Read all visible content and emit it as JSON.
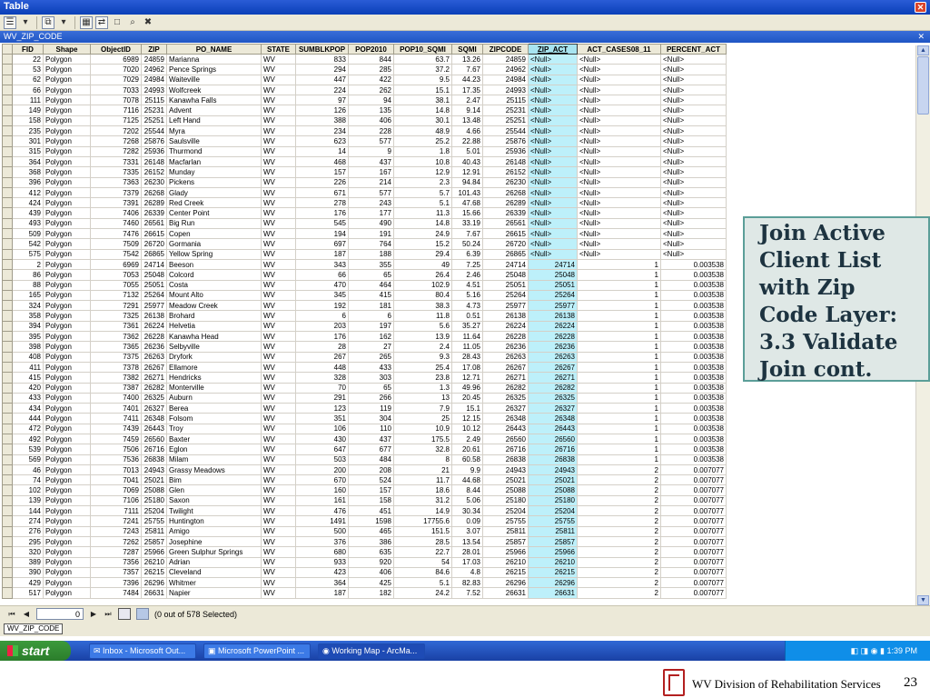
{
  "window": {
    "title": "Table",
    "close_glyph": "✕"
  },
  "toolbar": {
    "icons": [
      "table-options-icon",
      "dropdown-icon",
      "related-tables-icon",
      "dropdown-icon",
      "select-by-attributes-icon",
      "switch-selection-icon",
      "clear-selection-icon",
      "zoom-to-selected-icon",
      "delete-selected-icon"
    ]
  },
  "tab": {
    "title": "WV_ZIP_CODE",
    "close_glyph": "✕"
  },
  "table": {
    "columns": [
      "FID",
      "Shape",
      "ObjectID",
      "ZIP",
      "PO_NAME",
      "STATE",
      "SUMBLKPOP",
      "POP2010",
      "POP10_SQMI",
      "SQMI",
      "ZIPCODE",
      "ZIP_ACT",
      "ACT_CASES08_11",
      "PERCENT_ACT"
    ],
    "highlighted_column": "ZIP_ACT",
    "rows": [
      [
        "22",
        "Polygon",
        "6989",
        "24859",
        "Marianna",
        "WV",
        "833",
        "844",
        "63.7",
        "13.26",
        "24859",
        "<Null>",
        "<Null>",
        "<Null>"
      ],
      [
        "53",
        "Polygon",
        "7020",
        "24962",
        "Pence Springs",
        "WV",
        "294",
        "285",
        "37.2",
        "7.67",
        "24962",
        "<Null>",
        "<Null>",
        "<Null>"
      ],
      [
        "62",
        "Polygon",
        "7029",
        "24984",
        "Waiteville",
        "WV",
        "447",
        "422",
        "9.5",
        "44.23",
        "24984",
        "<Null>",
        "<Null>",
        "<Null>"
      ],
      [
        "66",
        "Polygon",
        "7033",
        "24993",
        "Wolfcreek",
        "WV",
        "224",
        "262",
        "15.1",
        "17.35",
        "24993",
        "<Null>",
        "<Null>",
        "<Null>"
      ],
      [
        "111",
        "Polygon",
        "7078",
        "25115",
        "Kanawha Falls",
        "WV",
        "97",
        "94",
        "38.1",
        "2.47",
        "25115",
        "<Null>",
        "<Null>",
        "<Null>"
      ],
      [
        "149",
        "Polygon",
        "7116",
        "25231",
        "Advent",
        "WV",
        "126",
        "135",
        "14.8",
        "9.14",
        "25231",
        "<Null>",
        "<Null>",
        "<Null>"
      ],
      [
        "158",
        "Polygon",
        "7125",
        "25251",
        "Left Hand",
        "WV",
        "388",
        "406",
        "30.1",
        "13.48",
        "25251",
        "<Null>",
        "<Null>",
        "<Null>"
      ],
      [
        "235",
        "Polygon",
        "7202",
        "25544",
        "Myra",
        "WV",
        "234",
        "228",
        "48.9",
        "4.66",
        "25544",
        "<Null>",
        "<Null>",
        "<Null>"
      ],
      [
        "301",
        "Polygon",
        "7268",
        "25876",
        "Saulsville",
        "WV",
        "623",
        "577",
        "25.2",
        "22.88",
        "25876",
        "<Null>",
        "<Null>",
        "<Null>"
      ],
      [
        "315",
        "Polygon",
        "7282",
        "25936",
        "Thurmond",
        "WV",
        "14",
        "9",
        "1.8",
        "5.01",
        "25936",
        "<Null>",
        "<Null>",
        "<Null>"
      ],
      [
        "364",
        "Polygon",
        "7331",
        "26148",
        "Macfarlan",
        "WV",
        "468",
        "437",
        "10.8",
        "40.43",
        "26148",
        "<Null>",
        "<Null>",
        "<Null>"
      ],
      [
        "368",
        "Polygon",
        "7335",
        "26152",
        "Munday",
        "WV",
        "157",
        "167",
        "12.9",
        "12.91",
        "26152",
        "<Null>",
        "<Null>",
        "<Null>"
      ],
      [
        "396",
        "Polygon",
        "7363",
        "26230",
        "Pickens",
        "WV",
        "226",
        "214",
        "2.3",
        "94.84",
        "26230",
        "<Null>",
        "<Null>",
        "<Null>"
      ],
      [
        "412",
        "Polygon",
        "7379",
        "26268",
        "Glady",
        "WV",
        "671",
        "577",
        "5.7",
        "101.43",
        "26268",
        "<Null>",
        "<Null>",
        "<Null>"
      ],
      [
        "424",
        "Polygon",
        "7391",
        "26289",
        "Red Creek",
        "WV",
        "278",
        "243",
        "5.1",
        "47.68",
        "26289",
        "<Null>",
        "<Null>",
        "<Null>"
      ],
      [
        "439",
        "Polygon",
        "7406",
        "26339",
        "Center Point",
        "WV",
        "176",
        "177",
        "11.3",
        "15.66",
        "26339",
        "<Null>",
        "<Null>",
        "<Null>"
      ],
      [
        "493",
        "Polygon",
        "7460",
        "26561",
        "Big Run",
        "WV",
        "545",
        "490",
        "14.8",
        "33.19",
        "26561",
        "<Null>",
        "<Null>",
        "<Null>"
      ],
      [
        "509",
        "Polygon",
        "7476",
        "26615",
        "Copen",
        "WV",
        "194",
        "191",
        "24.9",
        "7.67",
        "26615",
        "<Null>",
        "<Null>",
        "<Null>"
      ],
      [
        "542",
        "Polygon",
        "7509",
        "26720",
        "Gormania",
        "WV",
        "697",
        "764",
        "15.2",
        "50.24",
        "26720",
        "<Null>",
        "<Null>",
        "<Null>"
      ],
      [
        "575",
        "Polygon",
        "7542",
        "26865",
        "Yellow Spring",
        "WV",
        "187",
        "188",
        "29.4",
        "6.39",
        "26865",
        "<Null>",
        "<Null>",
        "<Null>"
      ],
      [
        "2",
        "Polygon",
        "6969",
        "24714",
        "Beeson",
        "WV",
        "343",
        "355",
        "49",
        "7.25",
        "24714",
        "24714",
        "1",
        "0.003538"
      ],
      [
        "86",
        "Polygon",
        "7053",
        "25048",
        "Colcord",
        "WV",
        "66",
        "65",
        "26.4",
        "2.46",
        "25048",
        "25048",
        "1",
        "0.003538"
      ],
      [
        "88",
        "Polygon",
        "7055",
        "25051",
        "Costa",
        "WV",
        "470",
        "464",
        "102.9",
        "4.51",
        "25051",
        "25051",
        "1",
        "0.003538"
      ],
      [
        "165",
        "Polygon",
        "7132",
        "25264",
        "Mount Alto",
        "WV",
        "345",
        "415",
        "80.4",
        "5.16",
        "25264",
        "25264",
        "1",
        "0.003538"
      ],
      [
        "324",
        "Polygon",
        "7291",
        "25977",
        "Meadow Creek",
        "WV",
        "192",
        "181",
        "38.3",
        "4.73",
        "25977",
        "25977",
        "1",
        "0.003538"
      ],
      [
        "358",
        "Polygon",
        "7325",
        "26138",
        "Brohard",
        "WV",
        "6",
        "6",
        "11.8",
        "0.51",
        "26138",
        "26138",
        "1",
        "0.003538"
      ],
      [
        "394",
        "Polygon",
        "7361",
        "26224",
        "Helvetia",
        "WV",
        "203",
        "197",
        "5.6",
        "35.27",
        "26224",
        "26224",
        "1",
        "0.003538"
      ],
      [
        "395",
        "Polygon",
        "7362",
        "26228",
        "Kanawha Head",
        "WV",
        "176",
        "162",
        "13.9",
        "11.64",
        "26228",
        "26228",
        "1",
        "0.003538"
      ],
      [
        "398",
        "Polygon",
        "7365",
        "26236",
        "Selbyville",
        "WV",
        "28",
        "27",
        "2.4",
        "11.05",
        "26236",
        "26236",
        "1",
        "0.003538"
      ],
      [
        "408",
        "Polygon",
        "7375",
        "26263",
        "Dryfork",
        "WV",
        "267",
        "265",
        "9.3",
        "28.43",
        "26263",
        "26263",
        "1",
        "0.003538"
      ],
      [
        "411",
        "Polygon",
        "7378",
        "26267",
        "Ellamore",
        "WV",
        "448",
        "433",
        "25.4",
        "17.08",
        "26267",
        "26267",
        "1",
        "0.003538"
      ],
      [
        "415",
        "Polygon",
        "7382",
        "26271",
        "Hendricks",
        "WV",
        "328",
        "303",
        "23.8",
        "12.71",
        "26271",
        "26271",
        "1",
        "0.003538"
      ],
      [
        "420",
        "Polygon",
        "7387",
        "26282",
        "Monterville",
        "WV",
        "70",
        "65",
        "1.3",
        "49.96",
        "26282",
        "26282",
        "1",
        "0.003538"
      ],
      [
        "433",
        "Polygon",
        "7400",
        "26325",
        "Auburn",
        "WV",
        "291",
        "266",
        "13",
        "20.45",
        "26325",
        "26325",
        "1",
        "0.003538"
      ],
      [
        "434",
        "Polygon",
        "7401",
        "26327",
        "Berea",
        "WV",
        "123",
        "119",
        "7.9",
        "15.1",
        "26327",
        "26327",
        "1",
        "0.003538"
      ],
      [
        "444",
        "Polygon",
        "7411",
        "26348",
        "Folsom",
        "WV",
        "351",
        "304",
        "25",
        "12.15",
        "26348",
        "26348",
        "1",
        "0.003538"
      ],
      [
        "472",
        "Polygon",
        "7439",
        "26443",
        "Troy",
        "WV",
        "106",
        "110",
        "10.9",
        "10.12",
        "26443",
        "26443",
        "1",
        "0.003538"
      ],
      [
        "492",
        "Polygon",
        "7459",
        "26560",
        "Baxter",
        "WV",
        "430",
        "437",
        "175.5",
        "2.49",
        "26560",
        "26560",
        "1",
        "0.003538"
      ],
      [
        "539",
        "Polygon",
        "7506",
        "26716",
        "Eglon",
        "WV",
        "647",
        "677",
        "32.8",
        "20.61",
        "26716",
        "26716",
        "1",
        "0.003538"
      ],
      [
        "569",
        "Polygon",
        "7536",
        "26838",
        "Milam",
        "WV",
        "503",
        "484",
        "8",
        "60.58",
        "26838",
        "26838",
        "1",
        "0.003538"
      ],
      [
        "46",
        "Polygon",
        "7013",
        "24943",
        "Grassy Meadows",
        "WV",
        "200",
        "208",
        "21",
        "9.9",
        "24943",
        "24943",
        "2",
        "0.007077"
      ],
      [
        "74",
        "Polygon",
        "7041",
        "25021",
        "Bim",
        "WV",
        "670",
        "524",
        "11.7",
        "44.68",
        "25021",
        "25021",
        "2",
        "0.007077"
      ],
      [
        "102",
        "Polygon",
        "7069",
        "25088",
        "Glen",
        "WV",
        "160",
        "157",
        "18.6",
        "8.44",
        "25088",
        "25088",
        "2",
        "0.007077"
      ],
      [
        "139",
        "Polygon",
        "7106",
        "25180",
        "Saxon",
        "WV",
        "161",
        "158",
        "31.2",
        "5.06",
        "25180",
        "25180",
        "2",
        "0.007077"
      ],
      [
        "144",
        "Polygon",
        "7111",
        "25204",
        "Twilight",
        "WV",
        "476",
        "451",
        "14.9",
        "30.34",
        "25204",
        "25204",
        "2",
        "0.007077"
      ],
      [
        "274",
        "Polygon",
        "7241",
        "25755",
        "Huntington",
        "WV",
        "1491",
        "1598",
        "17755.6",
        "0.09",
        "25755",
        "25755",
        "2",
        "0.007077"
      ],
      [
        "276",
        "Polygon",
        "7243",
        "25811",
        "Amigo",
        "WV",
        "500",
        "465",
        "151.5",
        "3.07",
        "25811",
        "25811",
        "2",
        "0.007077"
      ],
      [
        "295",
        "Polygon",
        "7262",
        "25857",
        "Josephine",
        "WV",
        "376",
        "386",
        "28.5",
        "13.54",
        "25857",
        "25857",
        "2",
        "0.007077"
      ],
      [
        "320",
        "Polygon",
        "7287",
        "25966",
        "Green Sulphur Springs",
        "WV",
        "680",
        "635",
        "22.7",
        "28.01",
        "25966",
        "25966",
        "2",
        "0.007077"
      ],
      [
        "389",
        "Polygon",
        "7356",
        "26210",
        "Adrian",
        "WV",
        "933",
        "920",
        "54",
        "17.03",
        "26210",
        "26210",
        "2",
        "0.007077"
      ],
      [
        "390",
        "Polygon",
        "7357",
        "26215",
        "Cleveland",
        "WV",
        "423",
        "406",
        "84.6",
        "4.8",
        "26215",
        "26215",
        "2",
        "0.007077"
      ],
      [
        "429",
        "Polygon",
        "7396",
        "26296",
        "Whitmer",
        "WV",
        "364",
        "425",
        "5.1",
        "82.83",
        "26296",
        "26296",
        "2",
        "0.007077"
      ],
      [
        "517",
        "Polygon",
        "7484",
        "26631",
        "Napier",
        "WV",
        "187",
        "182",
        "24.2",
        "7.52",
        "26631",
        "26631",
        "2",
        "0.007077"
      ]
    ]
  },
  "navigation": {
    "first": "⏮",
    "prev": "◀",
    "record": "0",
    "next": "▶",
    "last": "⏭",
    "status": "(0 out of 578 Selected)"
  },
  "bottom_tab": "WV_ZIP_CODE",
  "taskbar": {
    "start": "start",
    "tasks": [
      "Inbox - Microsoft Out...",
      "Microsoft PowerPoint ...",
      "Working Map - ArcMa..."
    ],
    "clock": "1:39 PM"
  },
  "caption": {
    "text": "Join Active Client List with Zip Code Layer: 3.3 Validate Join cont."
  },
  "footer": {
    "org": "WV Division of Rehabilitation Services",
    "page": "23"
  }
}
